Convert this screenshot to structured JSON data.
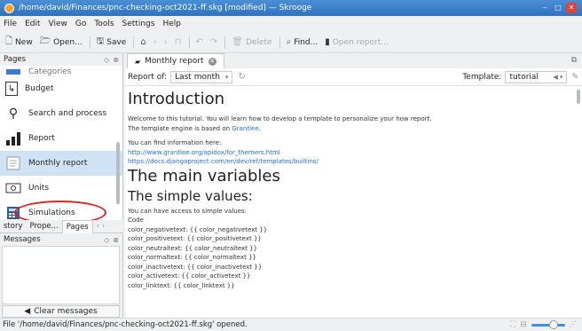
{
  "window": {
    "title": "/home/david/Finances/pnc-checking-oct2021-ff.skg [modified] — Skrooge",
    "buttons": {
      "minimize": "‒",
      "maximize": "□",
      "close": "✕"
    }
  },
  "menu": [
    "File",
    "Edit",
    "View",
    "Go",
    "Tools",
    "Settings",
    "Help"
  ],
  "toolbar": {
    "new": "New",
    "open": "Open...",
    "save": "Save",
    "delete": "Delete",
    "find": "Find...",
    "open_report": "Open report..."
  },
  "pages": {
    "header": "Pages",
    "items": [
      {
        "label": "Categories",
        "icon": "categories-icon"
      },
      {
        "label": "Budget",
        "icon": "budget-icon"
      },
      {
        "label": "Search and process",
        "icon": "search-icon"
      },
      {
        "label": "Report",
        "icon": "report-icon"
      },
      {
        "label": "Monthly report",
        "icon": "monthly-report-icon",
        "selected": true
      },
      {
        "label": "Units",
        "icon": "units-icon"
      },
      {
        "label": "Simulations",
        "icon": "simulations-icon"
      }
    ]
  },
  "dock_tabs": [
    "story",
    "Prope...",
    "Pages"
  ],
  "messages": {
    "header": "Messages",
    "clear_button": "Clear messages"
  },
  "document": {
    "tab_label": "Monthly report",
    "report_of_label": "Report of:",
    "report_period": "Last month",
    "template_label": "Template:",
    "template_value": "tutorial",
    "content": {
      "h_intro": "Introduction",
      "p1": "Welcome to this tutorial. You will learn how to develop a template to personalize your how report.",
      "p2_prefix": "The template engine is based on ",
      "p2_link": "Grantlee",
      "p2_suffix": ".",
      "p3": "You can find information here:",
      "link1": "http://www.grantlee.org/apidox/for_themers.html",
      "link2": "https://docs.djangoproject.com/en/dev/ref/templates/builtins/",
      "h_main": "The main variables",
      "h_simple": "The simple values:",
      "p4": "You can have access to simple values:",
      "code_label": "Code",
      "code_lines": [
        "color_negativetext: {{ color_negativetext }}",
        "color_positivetext: {{ color_positivetext }}",
        "color_neutraltext: {{ color_neutraltext }}",
        "color_normaltext: {{ color_normaltext }}",
        "color_inactivetext: {{ color_inactivetext }}",
        "color_activetext: {{ color_activetext }}",
        "color_linktext: {{ color_linktext }}"
      ]
    }
  },
  "statusbar": {
    "text": "File '/home/david/Finances/pnc-checking-oct2021-ff.skg' opened."
  },
  "colors": {
    "titlebar": "#2f73c0",
    "selection": "#cfe2f6",
    "highlight_oval": "#d82424",
    "link": "#2a6fd1"
  }
}
